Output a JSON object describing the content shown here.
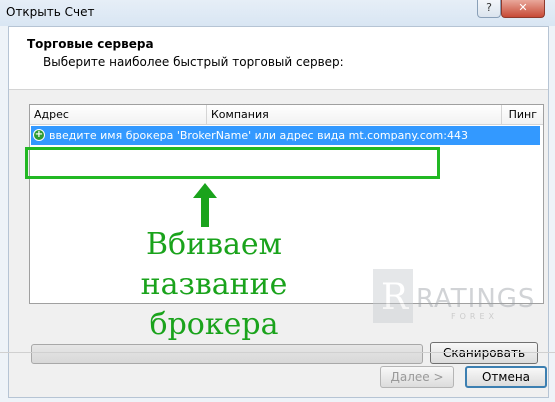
{
  "window": {
    "title": "Открыть Счет"
  },
  "header": {
    "title": "Торговые сервера",
    "subtitle": "Выберите наиболее быстрый торговый сервер:"
  },
  "table": {
    "columns": [
      "Адрес",
      "Компания",
      "Пинг"
    ],
    "rows": [
      {
        "text": "введите имя брокера 'BrokerName' или адрес вида mt.company.com:443",
        "selected": true
      }
    ]
  },
  "annotation": {
    "text": "Вбиваем название брокера",
    "color": "#1aa31c"
  },
  "watermark": {
    "text": "RATINGS",
    "sub": "FOREX"
  },
  "buttons": {
    "scan": "Сканировать",
    "next": "Далее >",
    "cancel": "Отмена"
  },
  "colors": {
    "selection": "#3399ff",
    "highlight_box": "#22b823"
  }
}
